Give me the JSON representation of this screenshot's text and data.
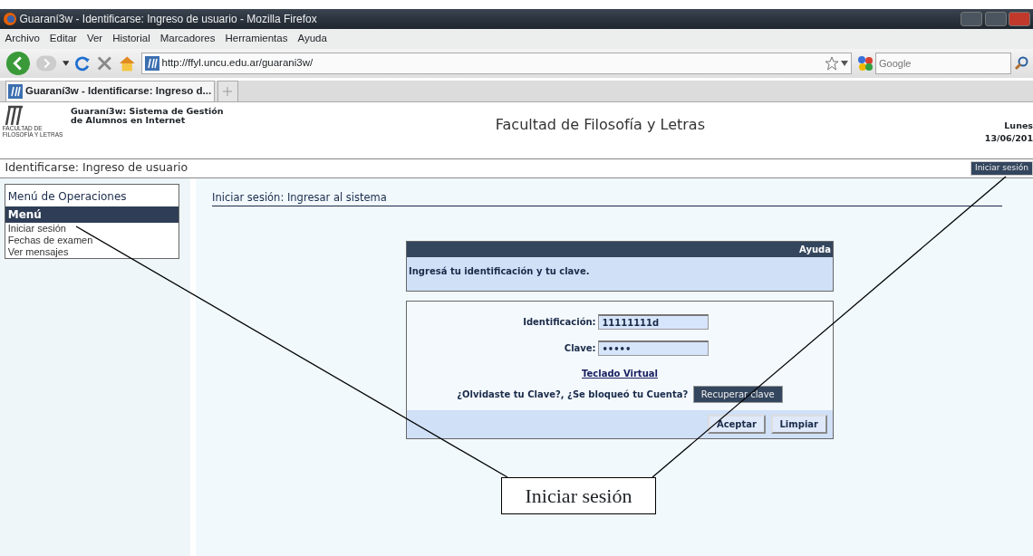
{
  "window": {
    "title": "Guaraní3w - Identificarse: Ingreso de usuario - Mozilla Firefox"
  },
  "menu_bar": [
    "Archivo",
    "Editar",
    "Ver",
    "Historial",
    "Marcadores",
    "Herramientas",
    "Ayuda"
  ],
  "toolbar": {
    "url": "http://ffyl.uncu.edu.ar/guarani3w/",
    "search_placeholder": "Google"
  },
  "tabs": [
    {
      "label": "Guaraní3w - Identificarse: Ingreso d...",
      "selected": true
    }
  ],
  "header": {
    "logo_text": [
      "FACULTAD DE",
      "FILOSOFÍA Y LETRAS"
    ],
    "system_name": [
      "Guaraní3w: Sistema de Gestión",
      "de Alumnos en Internet"
    ],
    "faculty": "Facultad de Filosofía y Letras",
    "day": "Lunes",
    "date": "13/06/201"
  },
  "page_title": "Identificarse: Ingreso de usuario",
  "login_button": "Iniciar sesión",
  "sidebar": {
    "title": "Menú de Operaciones",
    "section": "Menú",
    "items": [
      "Iniciar sesión",
      "Fechas de examen",
      "Ver mensajes"
    ]
  },
  "main": {
    "heading": "Iniciar sesión: Ingresar al sistema",
    "help": {
      "title": "Ayuda",
      "text": "Ingresá tu identificación y tu clave."
    },
    "form": {
      "fields": [
        {
          "label": "Identificación:",
          "value": "11111111d"
        },
        {
          "label": "Clave:",
          "value": "•••••"
        }
      ],
      "virtual_keyboard": "Teclado Virtual",
      "forgot_text": "¿Olvidaste tu Clave?, ¿Se bloqueó tu Cuenta?",
      "recover_button": "Recuperar clave",
      "buttons": [
        "Aceptar",
        "Limpiar"
      ]
    }
  },
  "annotation": {
    "label": "Iniciar sesión"
  }
}
